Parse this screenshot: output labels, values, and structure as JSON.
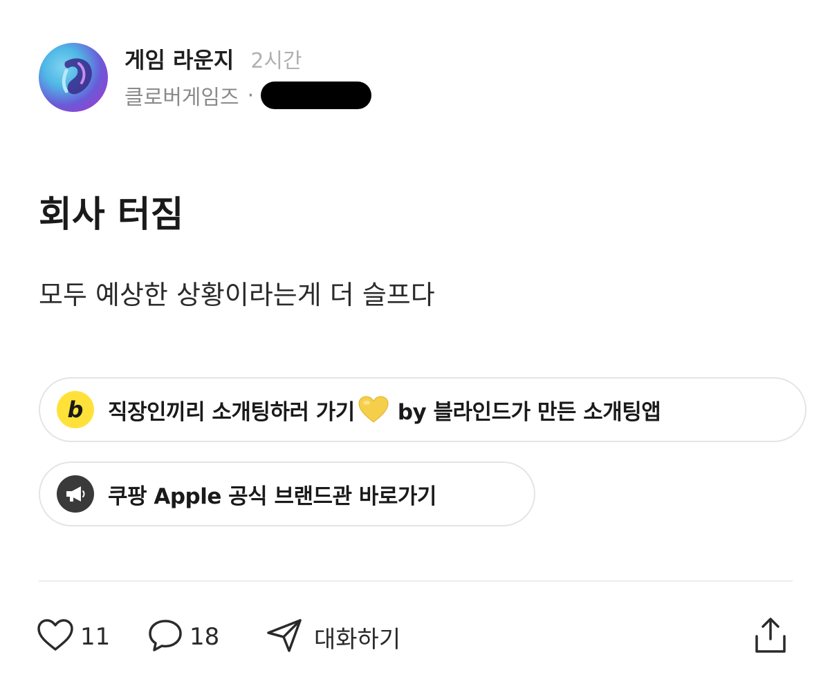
{
  "header": {
    "channel_name": "게임 라운지",
    "post_time": "2시간",
    "company": "클로버게임즈",
    "separator": "·"
  },
  "post": {
    "title": "회사 터짐",
    "body": "모두 예상한 상황이라는게 더 슬프다"
  },
  "promos": [
    {
      "icon": "blind-b-logo-icon",
      "icon_letter": "b",
      "text_before": "직장인끼리 소개팅하러 가기",
      "emoji": "yellow-heart-icon",
      "text_after": "by 블라인드가 만든 소개팅앱"
    },
    {
      "icon": "megaphone-icon",
      "text": "쿠팡 Apple 공식 브랜드관 바로가기"
    }
  ],
  "actions": {
    "likes": "11",
    "comments": "18",
    "chat_label": "대화하기"
  },
  "colors": {
    "promo_yellow": "#ffe13a",
    "promo_dark": "#3a3a3a",
    "muted_text": "#8a8a8a",
    "time_text": "#b0b0b0"
  }
}
